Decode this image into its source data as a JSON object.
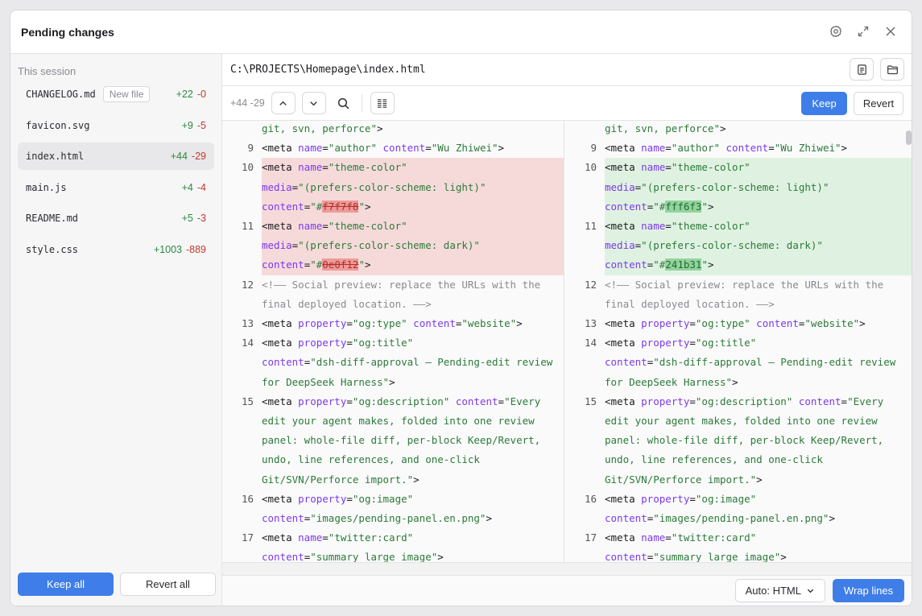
{
  "window": {
    "title": "Pending changes"
  },
  "window_icons": [
    "gear-icon",
    "expand-icon",
    "close-icon"
  ],
  "sidebar": {
    "section_label": "This session",
    "files": [
      {
        "name": "CHANGELOG.md",
        "badge": "New file",
        "add": "+22",
        "del": "-0",
        "active": false
      },
      {
        "name": "favicon.svg",
        "badge": "",
        "add": "+9",
        "del": "-5",
        "active": false
      },
      {
        "name": "index.html",
        "badge": "",
        "add": "+44",
        "del": "-29",
        "active": true
      },
      {
        "name": "main.js",
        "badge": "",
        "add": "+4",
        "del": "-4",
        "active": false
      },
      {
        "name": "README.md",
        "badge": "",
        "add": "+5",
        "del": "-3",
        "active": false
      },
      {
        "name": "style.css",
        "badge": "",
        "add": "+1003",
        "del": "-889",
        "active": false
      }
    ],
    "keep_all": "Keep all",
    "revert_all": "Revert all"
  },
  "path": {
    "value": "C:\\PROJECTS\\Homepage\\index.html"
  },
  "toolbar": {
    "count": "+44 -29",
    "keep": "Keep",
    "revert": "Revert"
  },
  "footer": {
    "language": "Auto: HTML",
    "wrap": "Wrap lines"
  },
  "colors": {
    "accent": "#3f7ee8",
    "add": "#2c8a3e",
    "del": "#c0392b"
  },
  "diff": {
    "left": [
      {
        "n": "",
        "segs": [
          [
            "t-str",
            "git, svn, perforce\""
          ],
          [
            "t-tag",
            ">"
          ]
        ]
      },
      {
        "n": "9",
        "segs": [
          [
            "t-tag",
            "<meta "
          ],
          [
            "t-attr",
            "name"
          ],
          [
            "t-tag",
            "="
          ],
          [
            "t-str",
            "\"author\" "
          ],
          [
            "t-attr",
            "content"
          ],
          [
            "t-tag",
            "="
          ],
          [
            "t-str",
            "\"Wu Zhiwei\""
          ],
          [
            "t-tag",
            ">"
          ]
        ]
      },
      {
        "n": "10",
        "bg": "del",
        "segs": [
          [
            "t-tag",
            "<meta "
          ],
          [
            "t-attr",
            "name"
          ],
          [
            "t-tag",
            "="
          ],
          [
            "t-str",
            "\"theme-color\""
          ]
        ]
      },
      {
        "n": "",
        "bg": "del",
        "segs": [
          [
            "t-attr",
            "media"
          ],
          [
            "t-tag",
            "="
          ],
          [
            "t-str",
            "\"(prefers-color-scheme: light)\""
          ]
        ]
      },
      {
        "n": "",
        "bg": "del",
        "segs": [
          [
            "t-attr",
            "content"
          ],
          [
            "t-tag",
            "="
          ],
          [
            "t-str",
            "\"#"
          ],
          [
            "hl-del",
            "f7f7f8"
          ],
          [
            "t-str",
            "\""
          ],
          [
            "t-tag",
            ">"
          ]
        ]
      },
      {
        "n": "11",
        "bg": "del",
        "segs": [
          [
            "t-tag",
            "<meta "
          ],
          [
            "t-attr",
            "name"
          ],
          [
            "t-tag",
            "="
          ],
          [
            "t-str",
            "\"theme-color\""
          ]
        ]
      },
      {
        "n": "",
        "bg": "del",
        "segs": [
          [
            "t-attr",
            "media"
          ],
          [
            "t-tag",
            "="
          ],
          [
            "t-str",
            "\"(prefers-color-scheme: dark)\""
          ]
        ]
      },
      {
        "n": "",
        "bg": "del",
        "segs": [
          [
            "t-attr",
            "content"
          ],
          [
            "t-tag",
            "="
          ],
          [
            "t-str",
            "\"#"
          ],
          [
            "hl-del",
            "0e0f12"
          ],
          [
            "t-str",
            "\""
          ],
          [
            "t-tag",
            ">"
          ]
        ]
      },
      {
        "n": "12",
        "segs": [
          [
            "t-cmt",
            "<!—— Social preview: replace the URLs with the"
          ]
        ]
      },
      {
        "n": "",
        "segs": [
          [
            "t-cmt",
            "final deployed location. ——>"
          ]
        ]
      },
      {
        "n": "13",
        "segs": [
          [
            "t-tag",
            "<meta "
          ],
          [
            "t-attr",
            "property"
          ],
          [
            "t-tag",
            "="
          ],
          [
            "t-str",
            "\"og:type\" "
          ],
          [
            "t-attr",
            "content"
          ],
          [
            "t-tag",
            "="
          ],
          [
            "t-str",
            "\"website\""
          ],
          [
            "t-tag",
            ">"
          ]
        ]
      },
      {
        "n": "14",
        "segs": [
          [
            "t-tag",
            "<meta "
          ],
          [
            "t-attr",
            "property"
          ],
          [
            "t-tag",
            "="
          ],
          [
            "t-str",
            "\"og:title\""
          ]
        ]
      },
      {
        "n": "",
        "segs": [
          [
            "t-attr",
            "content"
          ],
          [
            "t-tag",
            "="
          ],
          [
            "t-str",
            "\"dsh-diff-approval — Pending-edit review"
          ]
        ]
      },
      {
        "n": "",
        "segs": [
          [
            "t-str",
            "for DeepSeek Harness\""
          ],
          [
            "t-tag",
            ">"
          ]
        ]
      },
      {
        "n": "15",
        "segs": [
          [
            "t-tag",
            "<meta "
          ],
          [
            "t-attr",
            "property"
          ],
          [
            "t-tag",
            "="
          ],
          [
            "t-str",
            "\"og:description\" "
          ],
          [
            "t-attr",
            "content"
          ],
          [
            "t-tag",
            "="
          ],
          [
            "t-str",
            "\"Every"
          ]
        ]
      },
      {
        "n": "",
        "segs": [
          [
            "t-str",
            "edit your agent makes, folded into one review"
          ]
        ]
      },
      {
        "n": "",
        "segs": [
          [
            "t-str",
            "panel: whole-file diff, per-block Keep/Revert,"
          ]
        ]
      },
      {
        "n": "",
        "segs": [
          [
            "t-str",
            "undo, line references, and one-click"
          ]
        ]
      },
      {
        "n": "",
        "segs": [
          [
            "t-str",
            "Git/SVN/Perforce import.\""
          ],
          [
            "t-tag",
            ">"
          ]
        ]
      },
      {
        "n": "16",
        "segs": [
          [
            "t-tag",
            "<meta "
          ],
          [
            "t-attr",
            "property"
          ],
          [
            "t-tag",
            "="
          ],
          [
            "t-str",
            "\"og:image\""
          ]
        ]
      },
      {
        "n": "",
        "segs": [
          [
            "t-attr",
            "content"
          ],
          [
            "t-tag",
            "="
          ],
          [
            "t-str",
            "\"images/pending-panel.en.png\""
          ],
          [
            "t-tag",
            ">"
          ]
        ]
      },
      {
        "n": "17",
        "segs": [
          [
            "t-tag",
            "<meta "
          ],
          [
            "t-attr",
            "name"
          ],
          [
            "t-tag",
            "="
          ],
          [
            "t-str",
            "\"twitter:card\""
          ]
        ]
      },
      {
        "n": "",
        "segs": [
          [
            "t-attr",
            "content"
          ],
          [
            "t-tag",
            "="
          ],
          [
            "t-str",
            "\"summary_large_image\""
          ],
          [
            "t-tag",
            ">"
          ]
        ]
      }
    ],
    "right": [
      {
        "n": "",
        "segs": [
          [
            "t-str",
            "git, svn, perforce\""
          ],
          [
            "t-tag",
            ">"
          ]
        ]
      },
      {
        "n": "9",
        "segs": [
          [
            "t-tag",
            "<meta "
          ],
          [
            "t-attr",
            "name"
          ],
          [
            "t-tag",
            "="
          ],
          [
            "t-str",
            "\"author\" "
          ],
          [
            "t-attr",
            "content"
          ],
          [
            "t-tag",
            "="
          ],
          [
            "t-str",
            "\"Wu Zhiwei\""
          ],
          [
            "t-tag",
            ">"
          ]
        ]
      },
      {
        "n": "10",
        "bg": "add",
        "segs": [
          [
            "t-tag",
            "<meta "
          ],
          [
            "t-attr",
            "name"
          ],
          [
            "t-tag",
            "="
          ],
          [
            "t-str",
            "\"theme-color\""
          ]
        ]
      },
      {
        "n": "",
        "bg": "add",
        "segs": [
          [
            "t-attr",
            "media"
          ],
          [
            "t-tag",
            "="
          ],
          [
            "t-str",
            "\"(prefers-color-scheme: light)\""
          ]
        ]
      },
      {
        "n": "",
        "bg": "add",
        "segs": [
          [
            "t-attr",
            "content"
          ],
          [
            "t-tag",
            "="
          ],
          [
            "t-str",
            "\"#"
          ],
          [
            "hl-add",
            "fff6f3"
          ],
          [
            "t-str",
            "\""
          ],
          [
            "t-tag",
            ">"
          ]
        ]
      },
      {
        "n": "11",
        "bg": "add",
        "segs": [
          [
            "t-tag",
            "<meta "
          ],
          [
            "t-attr",
            "name"
          ],
          [
            "t-tag",
            "="
          ],
          [
            "t-str",
            "\"theme-color\""
          ]
        ]
      },
      {
        "n": "",
        "bg": "add",
        "segs": [
          [
            "t-attr",
            "media"
          ],
          [
            "t-tag",
            "="
          ],
          [
            "t-str",
            "\"(prefers-color-scheme: dark)\""
          ]
        ]
      },
      {
        "n": "",
        "bg": "add",
        "segs": [
          [
            "t-attr",
            "content"
          ],
          [
            "t-tag",
            "="
          ],
          [
            "t-str",
            "\"#"
          ],
          [
            "hl-add",
            "241b31"
          ],
          [
            "t-str",
            "\""
          ],
          [
            "t-tag",
            ">"
          ]
        ]
      },
      {
        "n": "12",
        "segs": [
          [
            "t-cmt",
            "<!—— Social preview: replace the URLs with the"
          ]
        ]
      },
      {
        "n": "",
        "segs": [
          [
            "t-cmt",
            "final deployed location. ——>"
          ]
        ]
      },
      {
        "n": "13",
        "segs": [
          [
            "t-tag",
            "<meta "
          ],
          [
            "t-attr",
            "property"
          ],
          [
            "t-tag",
            "="
          ],
          [
            "t-str",
            "\"og:type\" "
          ],
          [
            "t-attr",
            "content"
          ],
          [
            "t-tag",
            "="
          ],
          [
            "t-str",
            "\"website\""
          ],
          [
            "t-tag",
            ">"
          ]
        ]
      },
      {
        "n": "14",
        "segs": [
          [
            "t-tag",
            "<meta "
          ],
          [
            "t-attr",
            "property"
          ],
          [
            "t-tag",
            "="
          ],
          [
            "t-str",
            "\"og:title\""
          ]
        ]
      },
      {
        "n": "",
        "segs": [
          [
            "t-attr",
            "content"
          ],
          [
            "t-tag",
            "="
          ],
          [
            "t-str",
            "\"dsh-diff-approval — Pending-edit review"
          ]
        ]
      },
      {
        "n": "",
        "segs": [
          [
            "t-str",
            "for DeepSeek Harness\""
          ],
          [
            "t-tag",
            ">"
          ]
        ]
      },
      {
        "n": "15",
        "segs": [
          [
            "t-tag",
            "<meta "
          ],
          [
            "t-attr",
            "property"
          ],
          [
            "t-tag",
            "="
          ],
          [
            "t-str",
            "\"og:description\" "
          ],
          [
            "t-attr",
            "content"
          ],
          [
            "t-tag",
            "="
          ],
          [
            "t-str",
            "\"Every"
          ]
        ]
      },
      {
        "n": "",
        "segs": [
          [
            "t-str",
            "edit your agent makes, folded into one review"
          ]
        ]
      },
      {
        "n": "",
        "segs": [
          [
            "t-str",
            "panel: whole-file diff, per-block Keep/Revert,"
          ]
        ]
      },
      {
        "n": "",
        "segs": [
          [
            "t-str",
            "undo, line references, and one-click"
          ]
        ]
      },
      {
        "n": "",
        "segs": [
          [
            "t-str",
            "Git/SVN/Perforce import.\""
          ],
          [
            "t-tag",
            ">"
          ]
        ]
      },
      {
        "n": "16",
        "segs": [
          [
            "t-tag",
            "<meta "
          ],
          [
            "t-attr",
            "property"
          ],
          [
            "t-tag",
            "="
          ],
          [
            "t-str",
            "\"og:image\""
          ]
        ]
      },
      {
        "n": "",
        "segs": [
          [
            "t-attr",
            "content"
          ],
          [
            "t-tag",
            "="
          ],
          [
            "t-str",
            "\"images/pending-panel.en.png\""
          ],
          [
            "t-tag",
            ">"
          ]
        ]
      },
      {
        "n": "17",
        "segs": [
          [
            "t-tag",
            "<meta "
          ],
          [
            "t-attr",
            "name"
          ],
          [
            "t-tag",
            "="
          ],
          [
            "t-str",
            "\"twitter:card\""
          ]
        ]
      },
      {
        "n": "",
        "segs": [
          [
            "t-attr",
            "content"
          ],
          [
            "t-tag",
            "="
          ],
          [
            "t-str",
            "\"summary_large_image\""
          ],
          [
            "t-tag",
            ">"
          ]
        ]
      }
    ]
  }
}
